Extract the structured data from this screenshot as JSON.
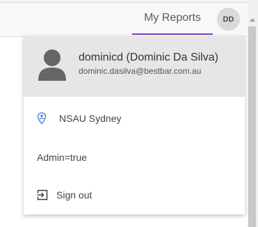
{
  "header": {
    "reports_tab": "My Reports",
    "avatar_initials": "DD",
    "accent_color": "#8a3ab9"
  },
  "user_menu": {
    "display_name": "dominicd (Dominic Da Silva)",
    "email": "dominic.dasilva@bestbar.com.au",
    "location": "NSAU Sydney",
    "admin_flag": "Admin=true",
    "sign_out": "Sign out",
    "icons": {
      "profile": "person-icon",
      "location": "location-pin-icon",
      "sign_out": "sign-out-icon"
    }
  }
}
